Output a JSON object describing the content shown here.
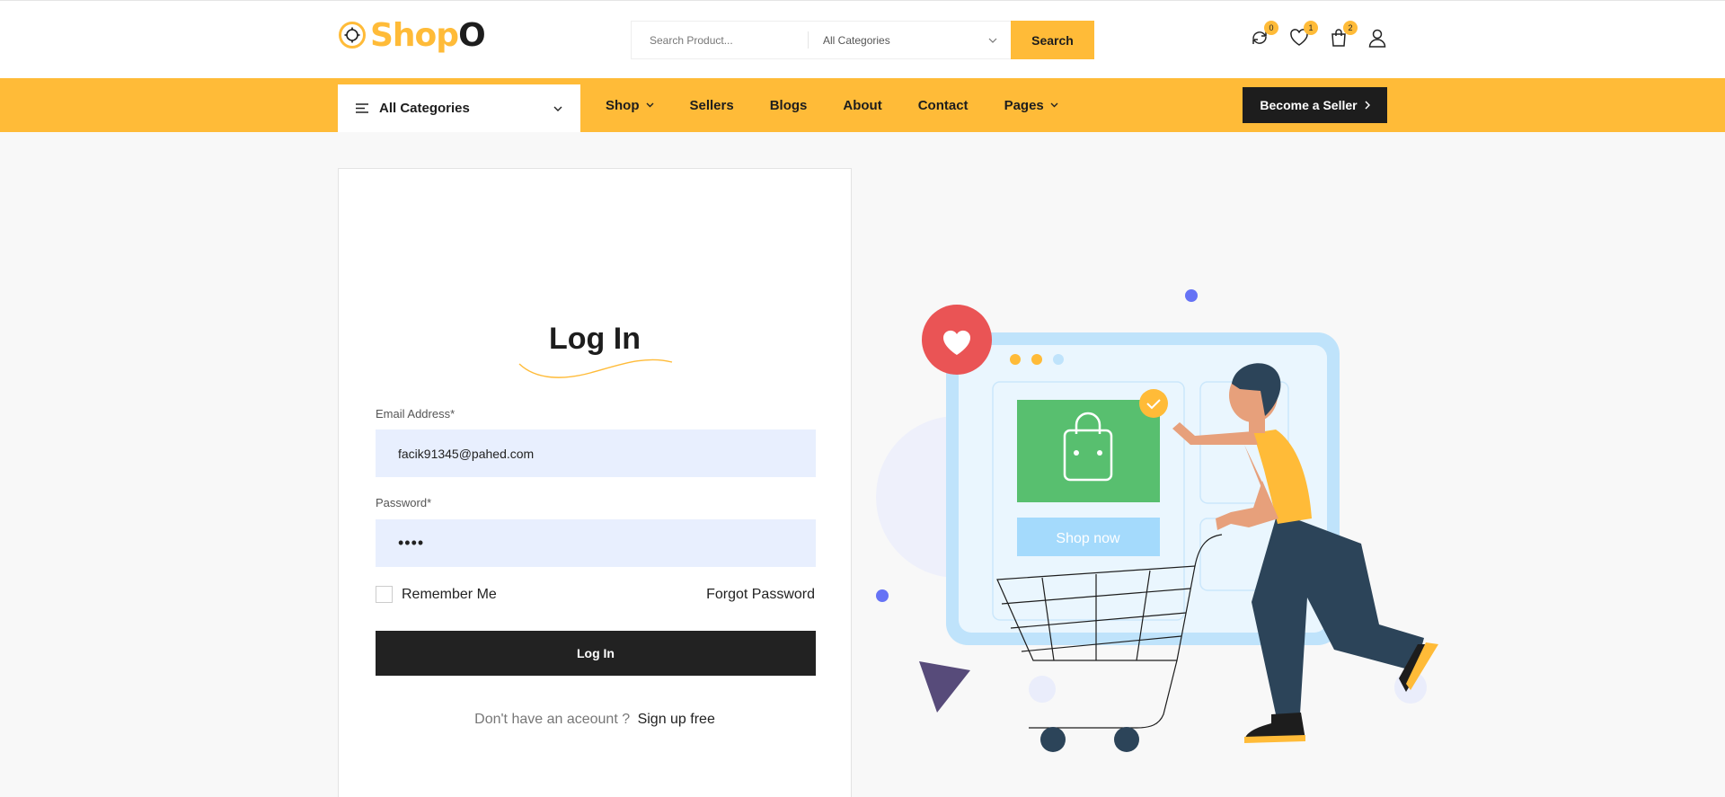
{
  "brand": {
    "name_part1": "Shop",
    "name_part2": "O",
    "accent_color": "#FFBB38",
    "dark_color": "#1D1D1D"
  },
  "header": {
    "search": {
      "placeholder": "Search Product...",
      "category_value": "All Categories",
      "button_label": "Search"
    },
    "icons": [
      {
        "name": "compare-icon",
        "badge": "0"
      },
      {
        "name": "heart-icon",
        "badge": "1"
      },
      {
        "name": "cart-icon",
        "badge": "2"
      },
      {
        "name": "user-icon",
        "badge": null
      }
    ]
  },
  "nav": {
    "categories_label": "All Categories",
    "links": [
      {
        "label": "Shop",
        "has_dropdown": true
      },
      {
        "label": "Sellers",
        "has_dropdown": false
      },
      {
        "label": "Blogs",
        "has_dropdown": false
      },
      {
        "label": "About",
        "has_dropdown": false
      },
      {
        "label": "Contact",
        "has_dropdown": false
      },
      {
        "label": "Pages",
        "has_dropdown": true
      }
    ],
    "seller_button": "Become a Seller"
  },
  "login": {
    "title": "Log In",
    "email_label": "Email Address*",
    "email_value": "facik91345@pahed.com",
    "password_label": "Password*",
    "password_value": "abcd",
    "remember_label": "Remember Me",
    "forgot_label": "Forgot Password",
    "submit_label": "Log In",
    "signup_question": "Don't have an aceount ?",
    "signup_link": "Sign up free"
  },
  "illustration": {
    "button_text": "Shop now"
  }
}
